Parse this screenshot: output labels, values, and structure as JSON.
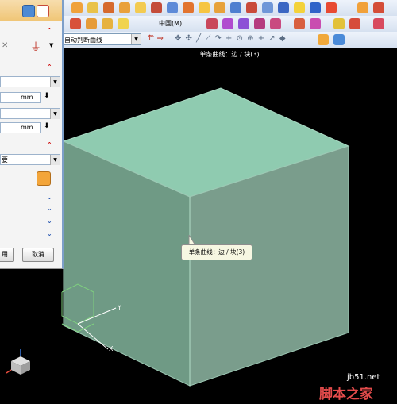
{
  "toolbar": {
    "view_menu_label": "中国(M)",
    "selection_filter_value": "自动判断曲线"
  },
  "status_bar": {
    "prompt": "单条曲线：边 / 块(3)"
  },
  "panel": {
    "unit_1": "mm",
    "unit_2": "mm",
    "partial_text_left": "要",
    "apply_button_partial": "用",
    "cancel_button_label": "取消"
  },
  "tooltip": {
    "text": "单条曲线：边 / 块(3)"
  },
  "watermark": {
    "url": "jb51.net",
    "site_name": "脚本之家"
  },
  "colors": {
    "cube_top": "#8fcbb0",
    "cube_left": "#6f9a85",
    "cube_right": "#7a9d8c",
    "background": "#000000",
    "wcs_axes": "#7fd07f"
  }
}
